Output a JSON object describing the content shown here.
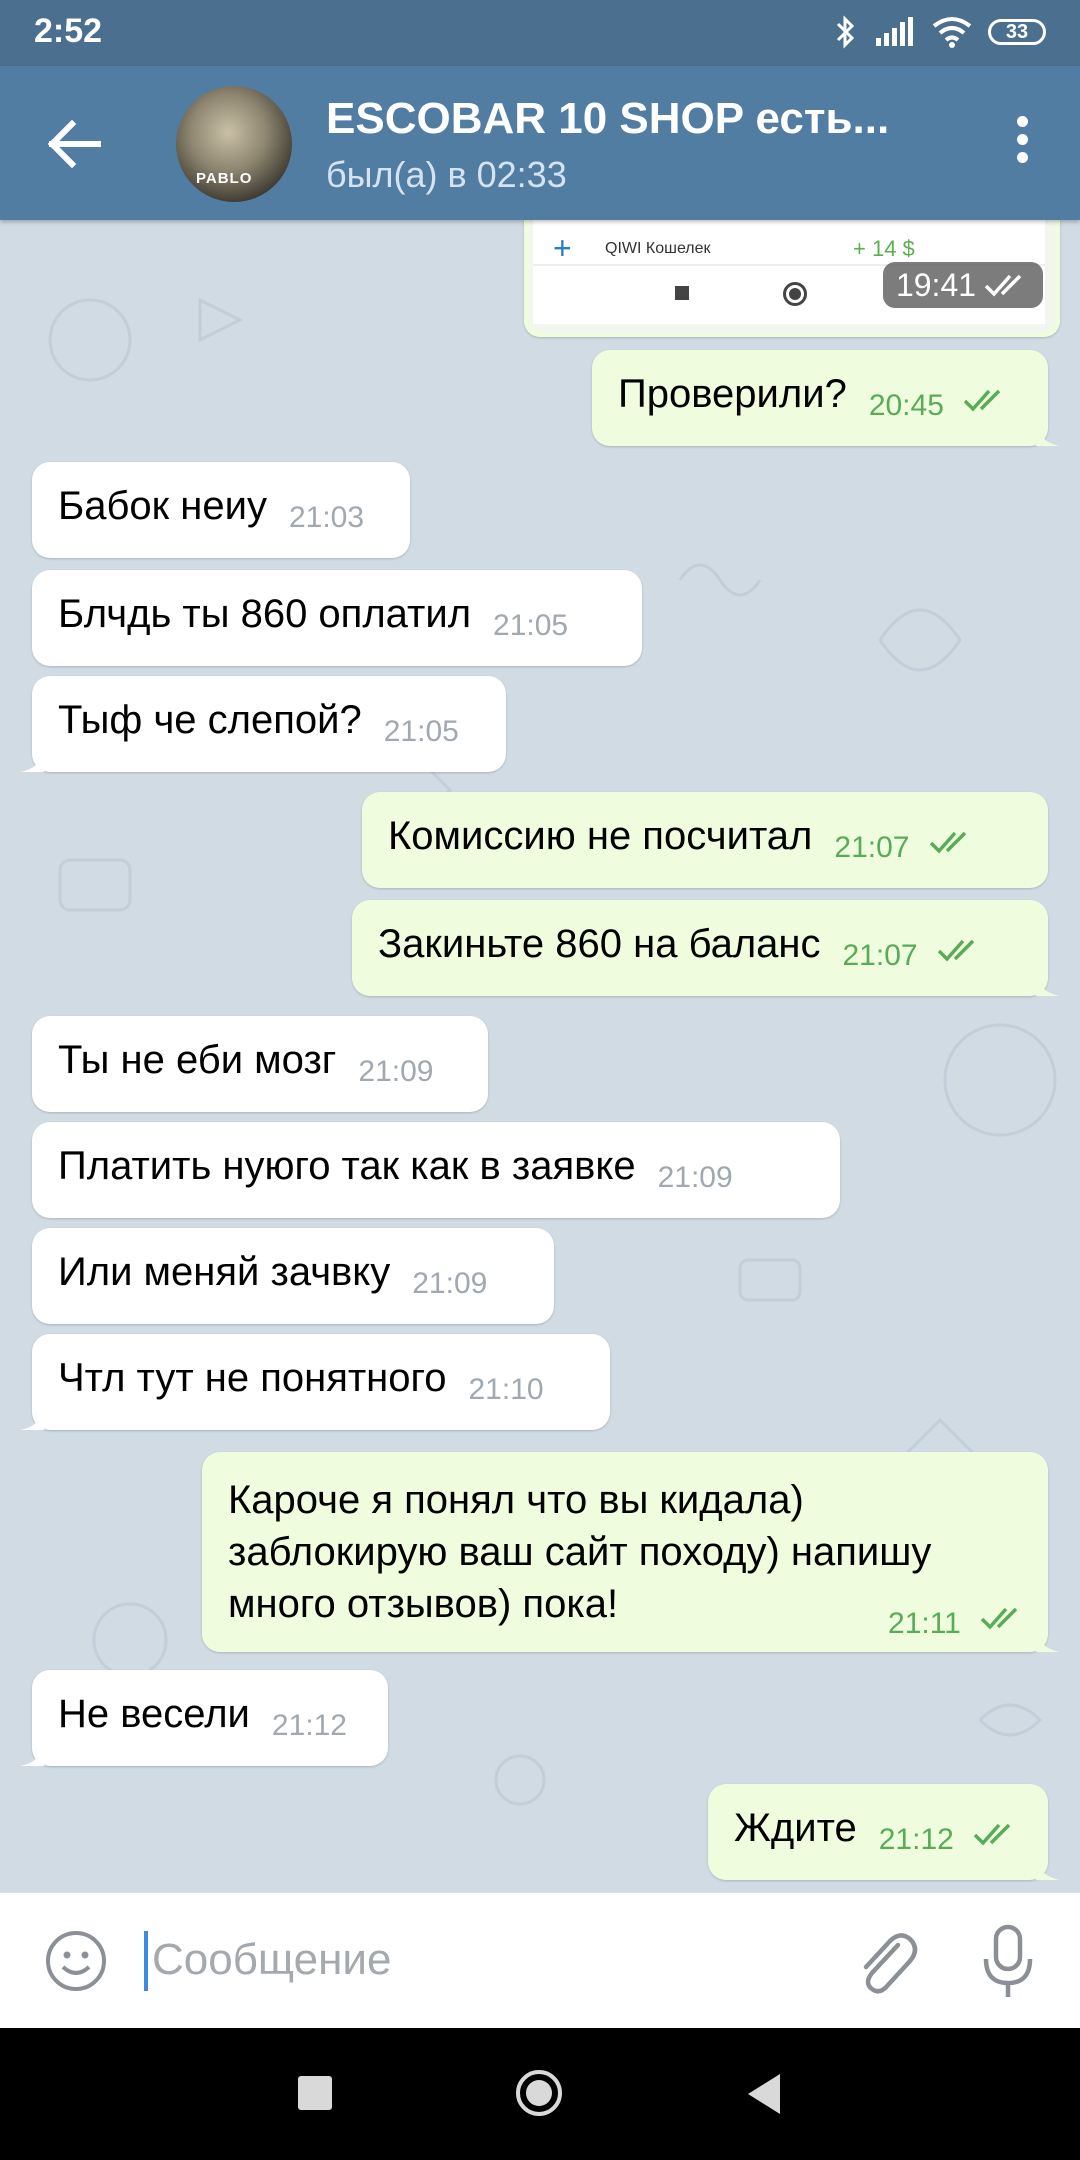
{
  "status_bar": {
    "time": "2:52",
    "battery": "33"
  },
  "header": {
    "title": "ESCOBAR 10 SHOP есть...",
    "subtitle": "был(а) в 02:33",
    "avatar_caption": "PABLO"
  },
  "qiwi_snippet": {
    "wallet_label": "QIWI Кошелек",
    "amount": "+ 14 $",
    "time": "19:41"
  },
  "messages": [
    {
      "dir": "out",
      "text": "Проверили?",
      "time": "20:45"
    },
    {
      "dir": "in",
      "text": "Бабок неиу",
      "time": "21:03"
    },
    {
      "dir": "in",
      "text": "Блчдь ты 860 оплатил",
      "time": "21:05"
    },
    {
      "dir": "in",
      "text": "Тыф че слепой?",
      "time": "21:05"
    },
    {
      "dir": "out",
      "text": "Комиссию не посчитал",
      "time": "21:07"
    },
    {
      "dir": "out",
      "text": "Закиньте 860 на баланс",
      "time": "21:07"
    },
    {
      "dir": "in",
      "text": "Ты не еби мозг",
      "time": "21:09"
    },
    {
      "dir": "in",
      "text": "Платить нуюго так как в заявке",
      "time": "21:09"
    },
    {
      "dir": "in",
      "text": "Или меняй зачвку",
      "time": "21:09"
    },
    {
      "dir": "in",
      "text": "Чтл тут не понятного",
      "time": "21:10"
    },
    {
      "dir": "out",
      "text": "Кароче я понял что вы кидала)\nзаблокирую ваш сайт походу) напишу\nмного отзывов) пока!",
      "time": "21:11"
    },
    {
      "dir": "in",
      "text": "Не весели",
      "time": "21:12"
    },
    {
      "dir": "out",
      "text": "Ждите",
      "time": "21:12"
    }
  ],
  "input": {
    "placeholder": "Сообщение"
  },
  "colors": {
    "header_bg": "#527da3",
    "status_bg": "#4b6f8f",
    "incoming_bubble": "#ffffff",
    "outgoing_bubble": "#effdde",
    "read_tick": "#5aab58",
    "wallpaper": "#d0dbe4"
  }
}
